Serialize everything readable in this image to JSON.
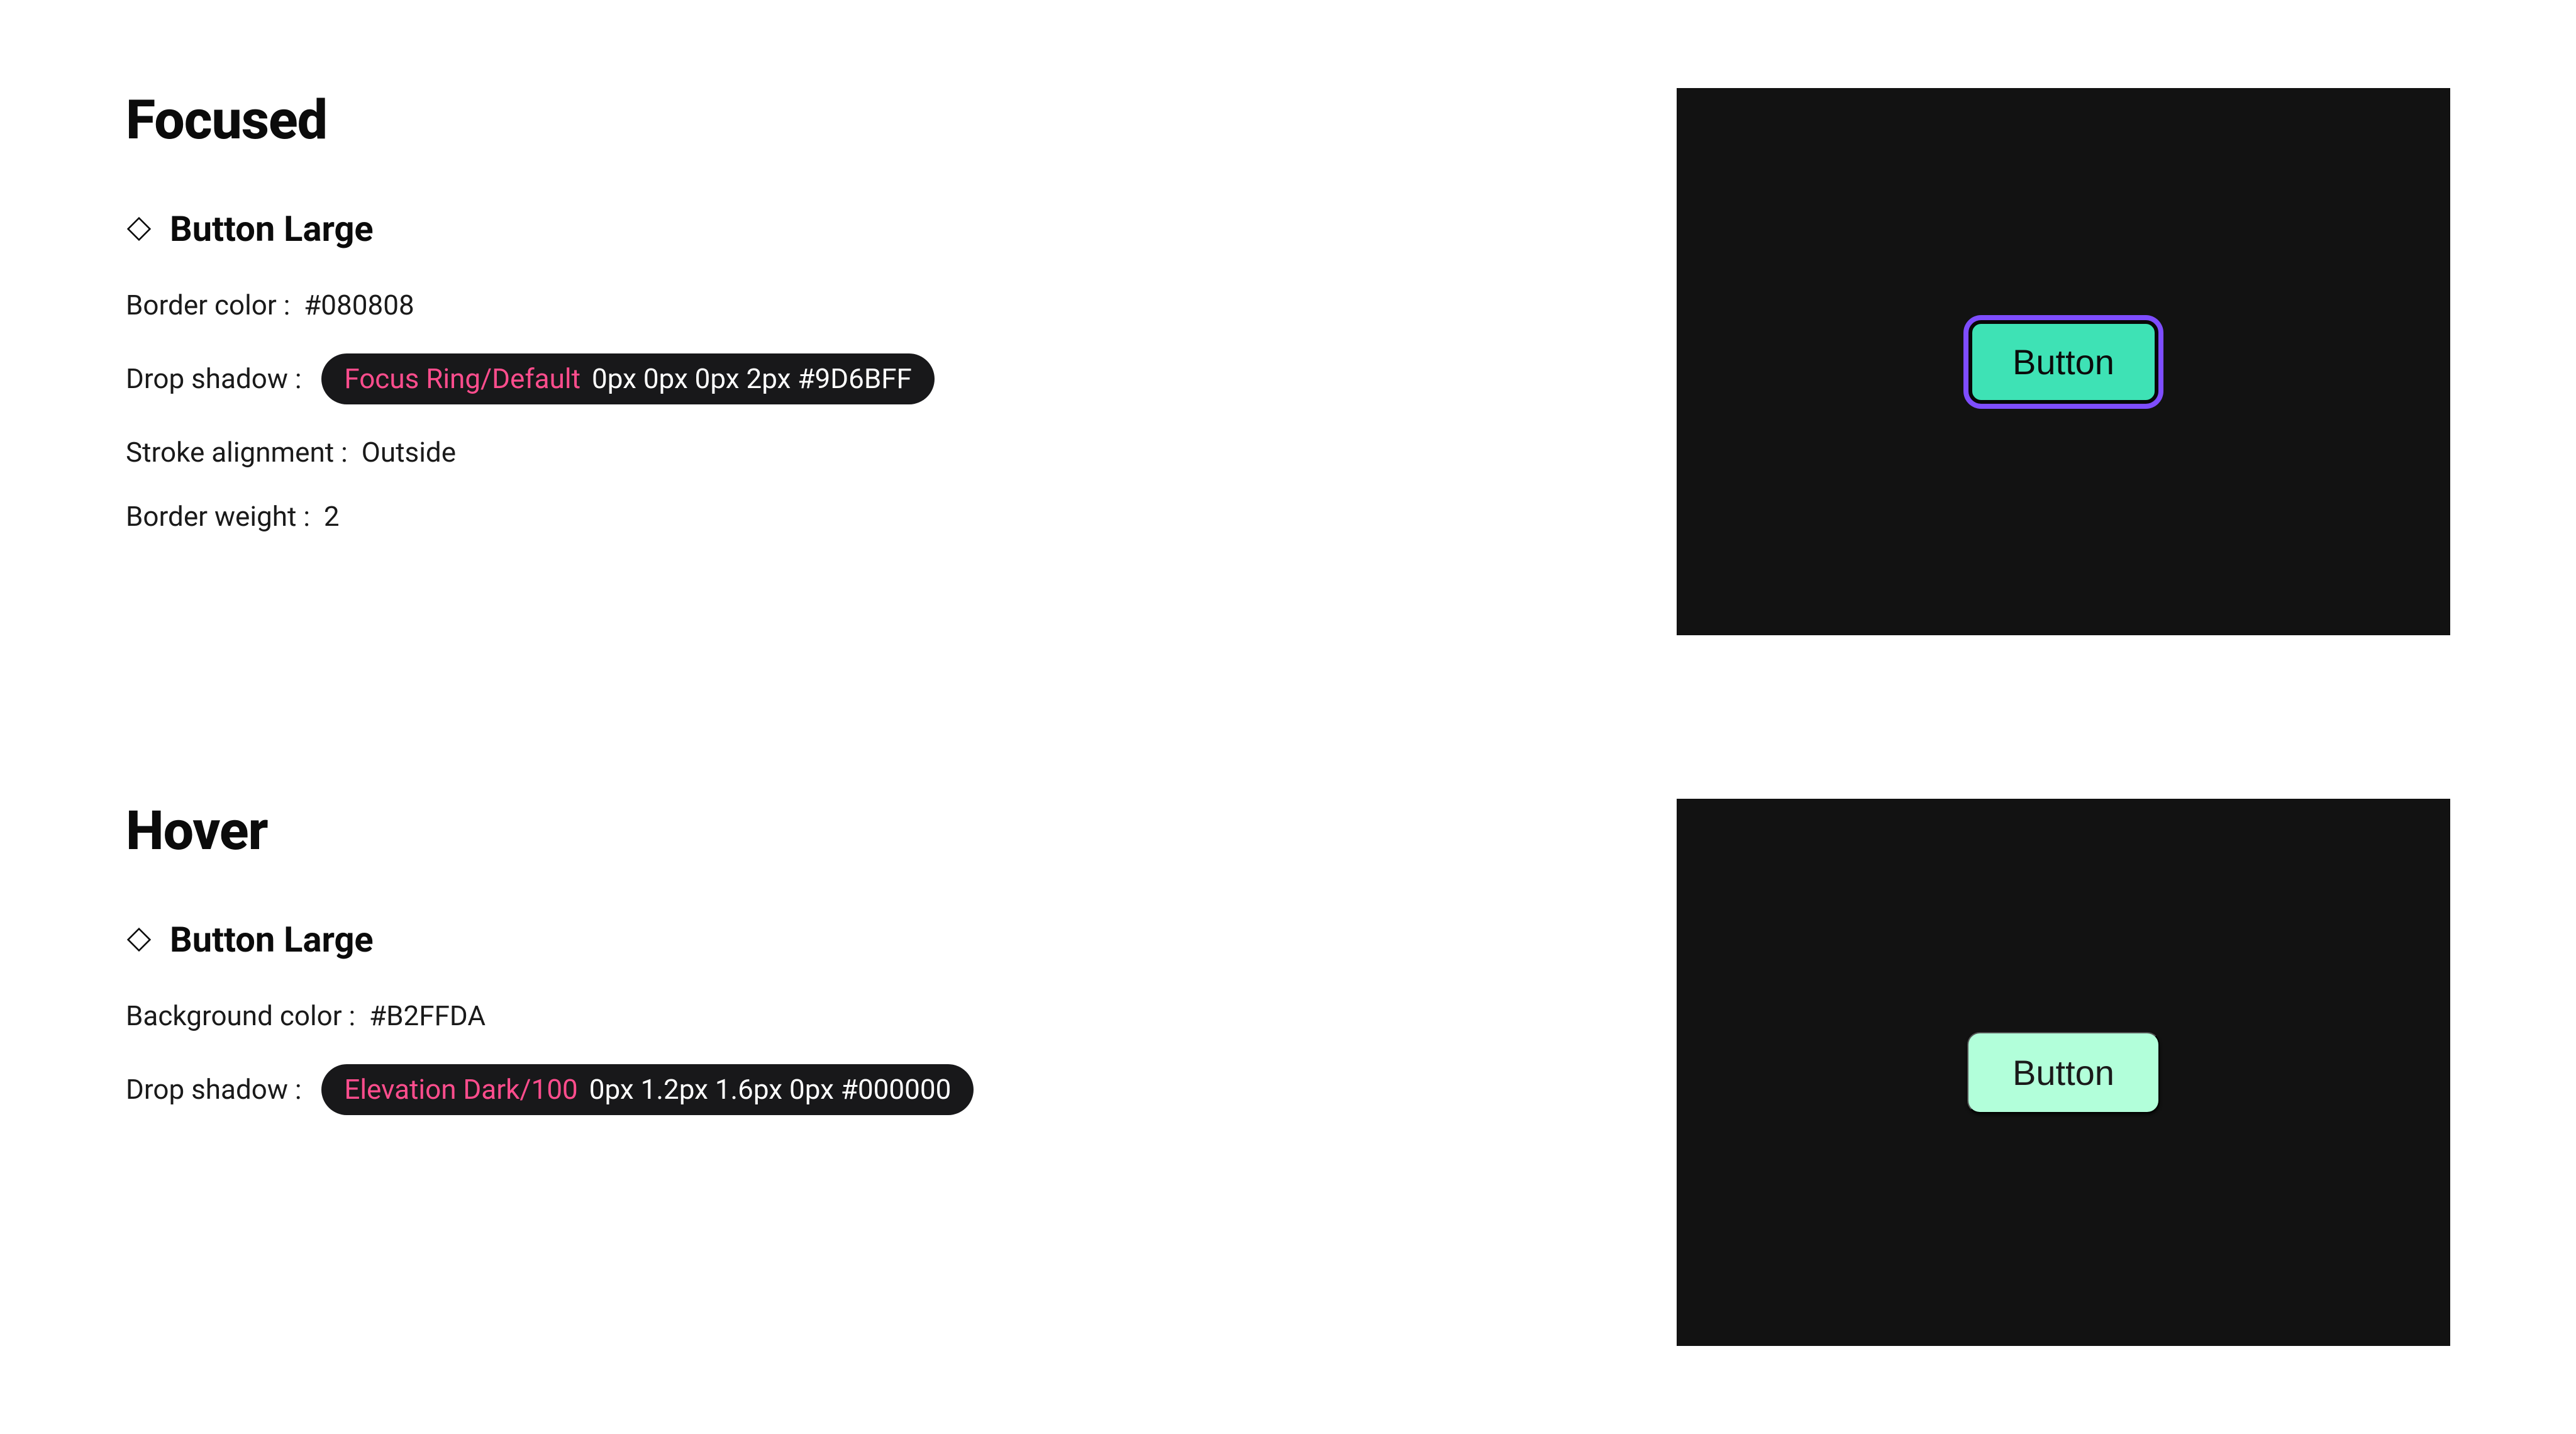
{
  "sections": [
    {
      "id": "focused",
      "title": "Focused",
      "component": "Button Large",
      "button_text": "Button",
      "specs": {
        "border_color": {
          "label": "Border color :  ",
          "value": "#080808"
        },
        "drop_shadow": {
          "label": "Drop shadow :  ",
          "pill_label": "Focus Ring/Default",
          "pill_value": "0px 0px 0px 2px #9D6BFF"
        },
        "stroke_alignment": {
          "label": "Stroke alignment :  ",
          "value": "Outside"
        },
        "border_weight": {
          "label": "Border weight :  ",
          "value": "2"
        }
      }
    },
    {
      "id": "hover",
      "title": "Hover",
      "component": "Button Large",
      "button_text": "Button",
      "specs": {
        "background_color": {
          "label": "Background color :  ",
          "value": "#B2FFDA"
        },
        "drop_shadow": {
          "label": "Drop shadow :  ",
          "pill_label": "Elevation Dark/100",
          "pill_value": "0px 1.2px 1.6px 0px #000000"
        }
      }
    }
  ]
}
